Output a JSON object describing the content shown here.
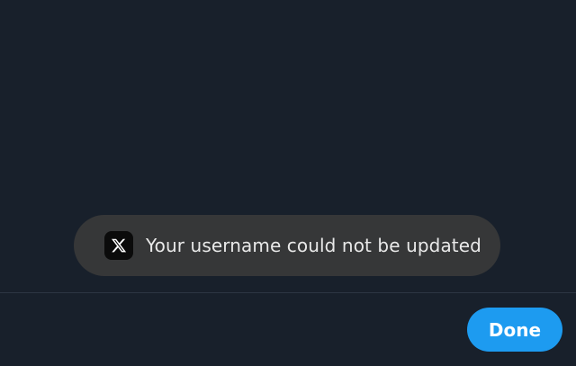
{
  "toast": {
    "icon": "x-logo-icon",
    "message": "Your username could not be updated"
  },
  "footer": {
    "done_label": "Done"
  },
  "colors": {
    "background": "#18202b",
    "toast_background": "#363738",
    "accent": "#1d9bf0"
  }
}
